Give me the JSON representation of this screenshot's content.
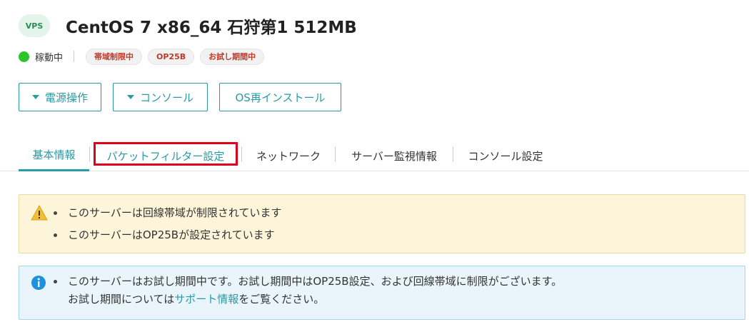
{
  "header": {
    "badge": "VPS",
    "title": "CentOS 7 x86_64 石狩第1 512MB"
  },
  "status": {
    "label": "稼動中",
    "color": "#2bc52b",
    "tags": [
      "帯域制限中",
      "OP25B",
      "お試し期間中"
    ]
  },
  "actions": {
    "power": "電源操作",
    "console": "コンソール",
    "reinstall": "OS再インストール"
  },
  "tabs": [
    "基本情報",
    "パケットフィルター設定",
    "ネットワーク",
    "サーバー監視情報",
    "コンソール設定"
  ],
  "active_tab": "基本情報",
  "highlighted_tab": "パケットフィルター設定",
  "warning": {
    "icon": "warning-icon",
    "items": [
      "このサーバーは回線帯域が制限されています",
      "このサーバーはOP25Bが設定されています"
    ]
  },
  "info": {
    "icon": "info-icon",
    "line1": "このサーバーはお試し期間中です。お試し期間中はOP25B設定、および回線帯域に制限がございます。",
    "line2_prefix": "お試し期間については",
    "line2_link": "サポート情報",
    "line2_suffix": "をご覧ください。"
  },
  "colors": {
    "accent": "#2a9aa3",
    "highlight": "#e0001b",
    "tag_text": "#c0392b"
  }
}
